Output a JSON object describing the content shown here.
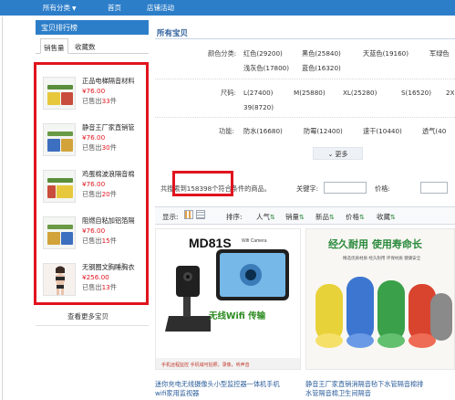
{
  "topnav": {
    "all_categories": "所有分类",
    "home": "首页",
    "shop_events": "店铺活动"
  },
  "sidebar": {
    "title": "宝贝排行榜",
    "tabs": [
      "销售量",
      "收藏数"
    ],
    "items": [
      {
        "title": "正品电梯隔音材料",
        "price": "¥76.00",
        "sold_prefix": "已售出",
        "sold_count": "33",
        "sold_suffix": "件"
      },
      {
        "title": "静音王厂家直销管",
        "price": "¥76.00",
        "sold_prefix": "已售出",
        "sold_count": "30",
        "sold_suffix": "件"
      },
      {
        "title": "鸡蛋棉波浪隔音棉",
        "price": "¥76.00",
        "sold_prefix": "已售出",
        "sold_count": "20",
        "sold_suffix": "件"
      },
      {
        "title": "阻燃自粘加铝箔隔",
        "price": "¥76.00",
        "sold_prefix": "已售出",
        "sold_count": "15",
        "sold_suffix": "件"
      },
      {
        "title": "无钢圈文胸睡胸衣",
        "price": "¥256.00",
        "sold_prefix": "已售出",
        "sold_count": "13",
        "sold_suffix": "件"
      }
    ],
    "more": "查看更多宝贝"
  },
  "main": {
    "title": "所有宝贝",
    "filters": {
      "color": {
        "label": "颜色分类:",
        "options": [
          "红色(29200)",
          "黑色(25840)",
          "天蓝色(19160)",
          "军绿色",
          "浅灰色(17800)",
          "蓝色(16320)"
        ]
      },
      "size": {
        "label": "尺码:",
        "options": [
          "L(27400)",
          "M(25880)",
          "XL(25280)",
          "S(16520)",
          "2X",
          "39(8720)"
        ]
      },
      "function": {
        "label": "功能:",
        "options": [
          "防水(16680)",
          "防霉(12400)",
          "速干(10440)",
          "透气(40"
        ]
      }
    },
    "more_button": "更多",
    "count": {
      "prefix": "共搜索到",
      "number": "158398",
      "suffix": "个符合条件的商品。"
    },
    "keyword_label": "关键字:",
    "price_label": "价格:",
    "sort": {
      "display_label": "显示:",
      "sort_label": "排序:",
      "options": [
        "人气",
        "销量",
        "新品",
        "价格",
        "收藏"
      ]
    },
    "products": [
      {
        "model": "MD81S",
        "badge": "Wifi Camera",
        "banner": "无线Wifi 传输",
        "tagline": "手机远程监控  手机域可拍照，录像，听声音",
        "caption_line1": "迷你充电无线摄像头小型监控器一体机手机",
        "caption_line2": "wifi家用监视器"
      },
      {
        "headline": "经久耐用 使用寿命长",
        "sub": "精选优质材质  经久耐用  环保材质  健康安全",
        "caption_line1": "静音王厂家直销消隔音毡下水管隔音棉排",
        "caption_line2": "水管隔音棉卫生间隔音"
      }
    ]
  },
  "colors": {
    "nav_blue": "#2d7ec9",
    "highlight_red": "#e0141e",
    "link_blue": "#2a5d9a",
    "green_accent": "#2a8a3c"
  }
}
